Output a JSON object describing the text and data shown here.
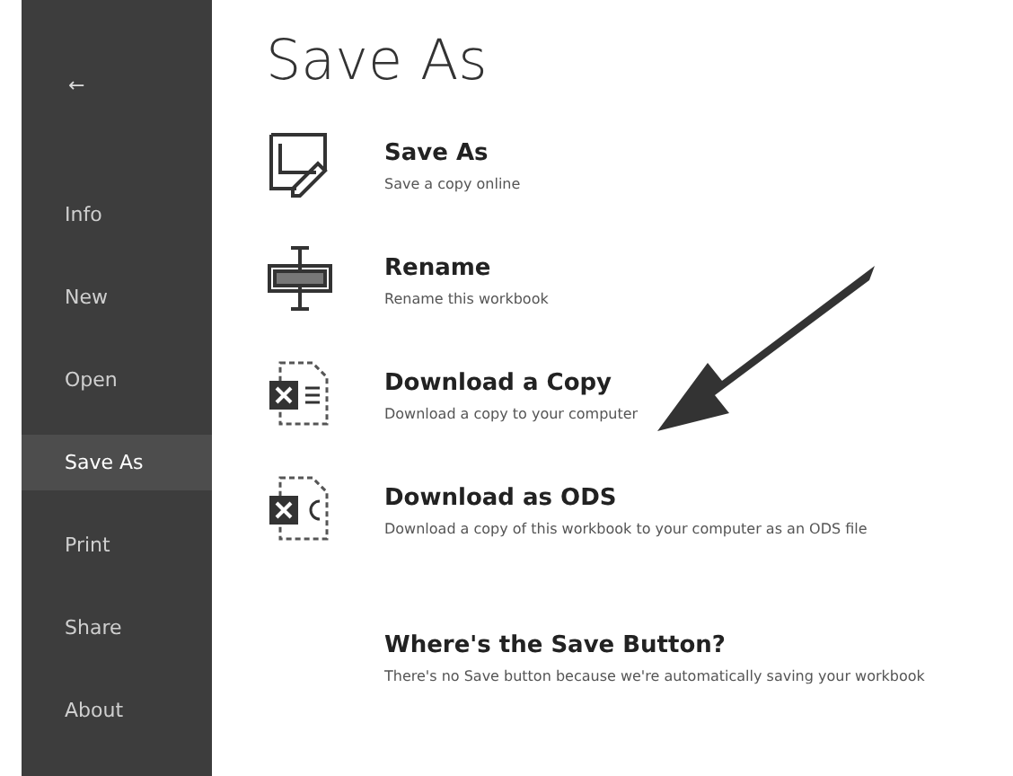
{
  "sidebar": {
    "back": "←",
    "items": [
      {
        "label": "Info",
        "selected": false
      },
      {
        "label": "New",
        "selected": false
      },
      {
        "label": "Open",
        "selected": false
      },
      {
        "label": "Save As",
        "selected": true
      },
      {
        "label": "Print",
        "selected": false
      },
      {
        "label": "Share",
        "selected": false
      },
      {
        "label": "About",
        "selected": false
      }
    ]
  },
  "title": "Save As",
  "options": [
    {
      "kind": "save-as",
      "title": "Save As",
      "description": "Save a copy online"
    },
    {
      "kind": "rename",
      "title": "Rename",
      "description": "Rename this workbook"
    },
    {
      "kind": "download",
      "title": "Download a Copy",
      "description": "Download a copy to your computer"
    },
    {
      "kind": "ods",
      "title": "Download as ODS",
      "description": "Download a copy of this workbook to your computer as an ODS file"
    },
    {
      "kind": "info",
      "title": "Where's the Save Button?",
      "description": "There's no Save button because we're automatically saving your workbook"
    }
  ]
}
